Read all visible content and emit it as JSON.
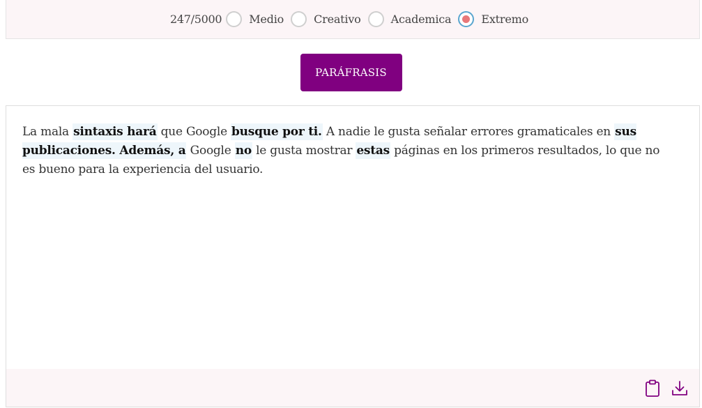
{
  "toolbar": {
    "counter": "247/5000",
    "modes": [
      {
        "label": "Medio",
        "selected": false
      },
      {
        "label": "Creativo",
        "selected": false
      },
      {
        "label": "Academica",
        "selected": false
      },
      {
        "label": "Extremo",
        "selected": true
      }
    ]
  },
  "actions": {
    "paraphrase_label": "PARÁFRASIS"
  },
  "output": {
    "segments": [
      {
        "text": "La mala ",
        "highlight": false
      },
      {
        "text": "sintaxis hará",
        "highlight": true
      },
      {
        "text": " que Google ",
        "highlight": false
      },
      {
        "text": "busque por ti.",
        "highlight": true
      },
      {
        "text": " A nadie le gusta señalar errores gramaticales en ",
        "highlight": false
      },
      {
        "text": "sus publicaciones. Además, a",
        "highlight": true
      },
      {
        "text": " Google ",
        "highlight": false
      },
      {
        "text": "no",
        "highlight": true
      },
      {
        "text": " le gusta mostrar ",
        "highlight": false
      },
      {
        "text": "estas",
        "highlight": true
      },
      {
        "text": " páginas en los primeros resultados, lo que no es bueno para la experiencia del usuario.",
        "highlight": false
      }
    ]
  },
  "footer": {
    "icons": [
      "clipboard-icon",
      "download-icon"
    ]
  },
  "colors": {
    "accent": "#800080",
    "radio_checked_ring": "#5aa6cf",
    "radio_checked_dot": "#e8787a",
    "highlight_bg": "#eef6fb",
    "bar_bg": "#fcf5f7"
  }
}
